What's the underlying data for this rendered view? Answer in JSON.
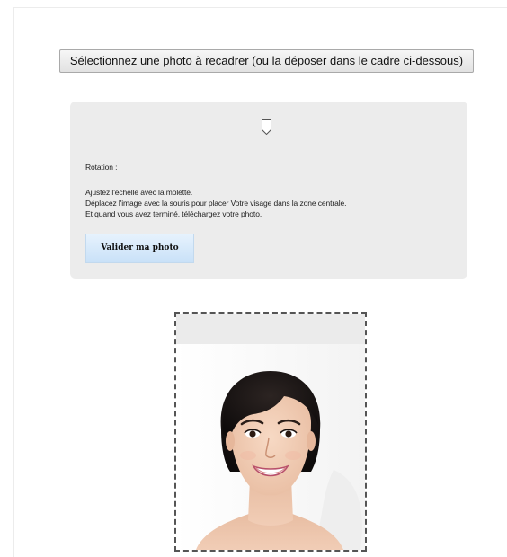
{
  "select_button": {
    "label": "Sélectionnez une photo à recadrer (ou la déposer dans le cadre ci-dessous)"
  },
  "editor": {
    "slider_level": 0.5,
    "rotation_label": "Rotation :",
    "instructions": [
      "Ajustez l'échelle avec la molette.",
      "Déplacez l'image avec la souris pour placer Votre visage dans la zone centrale.",
      "Et quand vous avez terminé, téléchargez votre photo."
    ],
    "validate_label": "Valider ma photo"
  },
  "colors": {
    "panel_background": "#ececec",
    "validate_button": "#cfe5fa",
    "crop_border": "#555555"
  },
  "icons": {
    "slider_thumb": "slider-thumb-icon",
    "portrait": "portrait-photo"
  }
}
